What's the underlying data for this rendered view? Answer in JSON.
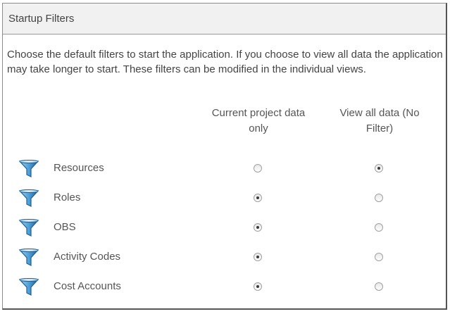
{
  "panel": {
    "title": "Startup Filters",
    "description": "Choose the default filters to start the application.  If you choose to view all data the application may take longer to start.  These filters can be modified in the individual views."
  },
  "columns": {
    "current": "Current project data only",
    "all": "View all data (No Filter)"
  },
  "rows": [
    {
      "label": "Resources",
      "selected": "all"
    },
    {
      "label": "Roles",
      "selected": "current"
    },
    {
      "label": "OBS",
      "selected": "current"
    },
    {
      "label": "Activity Codes",
      "selected": "current"
    },
    {
      "label": "Cost Accounts",
      "selected": "current"
    }
  ],
  "icons": {
    "filter": "funnel-icon"
  },
  "colors": {
    "funnel": "#4f9fd6",
    "funnel_dark": "#1f5f9a"
  }
}
